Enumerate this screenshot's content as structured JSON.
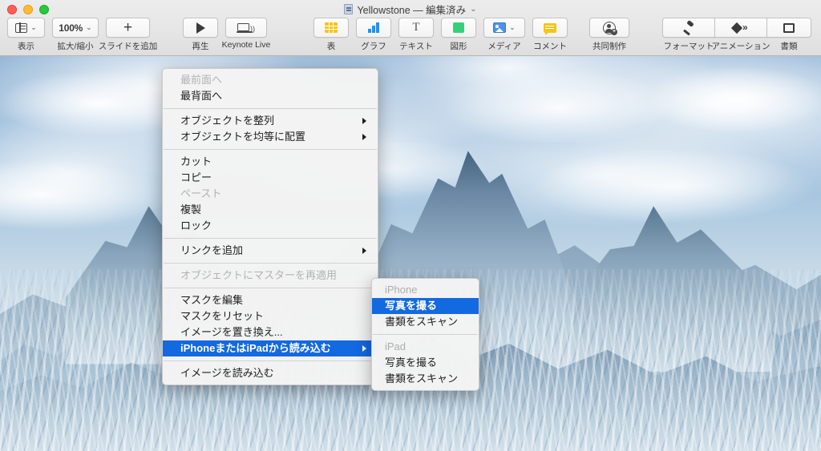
{
  "window": {
    "title": "Yellowstone — 編集済み",
    "title_chevron": "chevron-down",
    "traffic_lights": [
      "close",
      "minimize",
      "zoom"
    ]
  },
  "toolbar": {
    "left_group": [
      {
        "label": "表示",
        "icon": "view-panes-icon",
        "has_chevron": true
      },
      {
        "label": "拡大/縮小",
        "icon": "zoom-level",
        "value": "100%",
        "has_chevron": true
      },
      {
        "label": "スライドを追加",
        "icon": "plus-icon",
        "has_chevron": false
      }
    ],
    "play_group": [
      {
        "label": "再生",
        "icon": "play-icon"
      },
      {
        "label": "Keynote Live",
        "icon": "keynote-live-icon"
      }
    ],
    "insert_group": [
      {
        "label": "表",
        "icon": "table-icon",
        "color": "#f5c518"
      },
      {
        "label": "グラフ",
        "icon": "chart-icon",
        "color": "#2d8fe8"
      },
      {
        "label": "テキスト",
        "icon": "text-icon",
        "color": "#555555"
      },
      {
        "label": "図形",
        "icon": "shape-icon",
        "color": "#35d17a"
      },
      {
        "label": "メディア",
        "icon": "media-icon",
        "color": "#4d93e0",
        "has_chevron": true
      },
      {
        "label": "コメント",
        "icon": "comment-icon",
        "color": "#f5c518"
      }
    ],
    "collab_group": [
      {
        "label": "共同制作",
        "icon": "collaborate-icon"
      }
    ],
    "right_group": [
      {
        "label": "フォーマット",
        "icon": "format-brush-icon"
      },
      {
        "label": "アニメーション",
        "icon": "animate-diamond-icon"
      },
      {
        "label": "書類",
        "icon": "document-icon"
      }
    ]
  },
  "context_menu": {
    "items": [
      {
        "label": "最前面へ",
        "disabled": true,
        "submenu": false,
        "selected": false
      },
      {
        "label": "最背面へ",
        "disabled": false,
        "submenu": false,
        "selected": false
      },
      {
        "separator": true
      },
      {
        "label": "オブジェクトを整列",
        "disabled": false,
        "submenu": true,
        "selected": false
      },
      {
        "label": "オブジェクトを均等に配置",
        "disabled": false,
        "submenu": true,
        "selected": false
      },
      {
        "separator": true
      },
      {
        "label": "カット",
        "disabled": false,
        "submenu": false,
        "selected": false
      },
      {
        "label": "コピー",
        "disabled": false,
        "submenu": false,
        "selected": false
      },
      {
        "label": "ペースト",
        "disabled": true,
        "submenu": false,
        "selected": false
      },
      {
        "label": "複製",
        "disabled": false,
        "submenu": false,
        "selected": false
      },
      {
        "label": "ロック",
        "disabled": false,
        "submenu": false,
        "selected": false
      },
      {
        "separator": true
      },
      {
        "label": "リンクを追加",
        "disabled": false,
        "submenu": true,
        "selected": false
      },
      {
        "separator": true
      },
      {
        "label": "オブジェクトにマスターを再適用",
        "disabled": true,
        "submenu": false,
        "selected": false
      },
      {
        "separator": true
      },
      {
        "label": "マスクを編集",
        "disabled": false,
        "submenu": false,
        "selected": false
      },
      {
        "label": "マスクをリセット",
        "disabled": false,
        "submenu": false,
        "selected": false
      },
      {
        "label": "イメージを置き換え...",
        "disabled": false,
        "submenu": false,
        "selected": false
      },
      {
        "label": "iPhoneまたはiPadから読み込む",
        "disabled": false,
        "submenu": true,
        "selected": true
      },
      {
        "separator": true
      },
      {
        "label": "イメージを読み込む",
        "disabled": false,
        "submenu": false,
        "selected": false
      }
    ]
  },
  "submenu": {
    "items": [
      {
        "label": "iPhone",
        "header": true,
        "selected": false
      },
      {
        "label": "写真を撮る",
        "header": false,
        "selected": true
      },
      {
        "label": "書類をスキャン",
        "header": false,
        "selected": false
      },
      {
        "separator": true
      },
      {
        "label": "iPad",
        "header": true,
        "selected": false
      },
      {
        "label": "写真を撮る",
        "header": false,
        "selected": false
      },
      {
        "label": "書類をスキャン",
        "header": false,
        "selected": false
      }
    ]
  },
  "slide": {
    "content_description": "snow-covered-mountain-photo"
  },
  "colors": {
    "menu_highlight": "#1369e0",
    "menu_background": "#f3f3f3",
    "toolbar_background": "#e9e9e9",
    "disabled_text": "#b2b2b2"
  }
}
